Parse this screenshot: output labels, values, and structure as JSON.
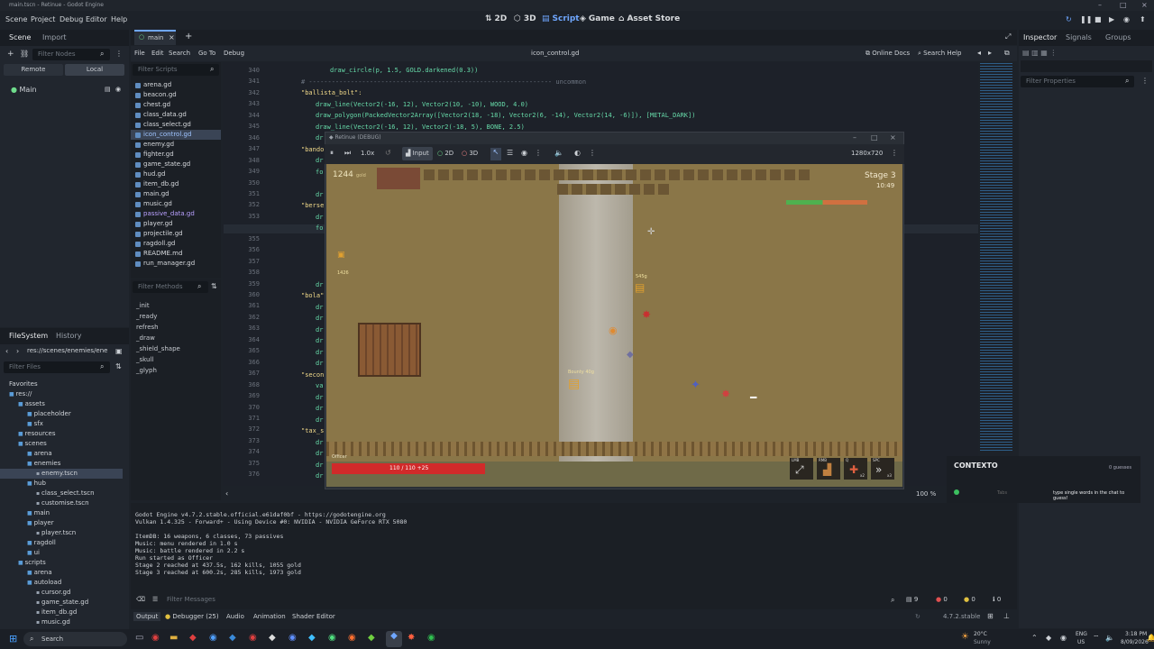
{
  "window": {
    "title": "main.tscn - Retinue - Godot Engine"
  },
  "menu": [
    "Scene",
    "Project",
    "Debug",
    "Editor",
    "Help"
  ],
  "modes": [
    {
      "icon": "2d-icon",
      "label": "2D",
      "active": false
    },
    {
      "icon": "3d-icon",
      "label": "3D",
      "active": false
    },
    {
      "icon": "script-icon",
      "label": "Script",
      "active": true
    },
    {
      "icon": "game-icon",
      "label": "Game",
      "active": false
    },
    {
      "icon": "assetlib-icon",
      "label": "Asset Store",
      "active": false
    }
  ],
  "scene_dock": {
    "tabs": [
      "Scene",
      "Import"
    ],
    "filter_placeholder": "Filter Nodes",
    "remote_label": "Remote",
    "local_label": "Local",
    "root_node": "Main"
  },
  "editor_tabs": {
    "main_tab": "main",
    "add": "+"
  },
  "script_menu": [
    "File",
    "Edit",
    "Search",
    "Go To",
    "Debug"
  ],
  "script_title": "icon_control.gd",
  "online_docs": "Online Docs",
  "search_help": "Search Help",
  "scripts_filter": "Filter Scripts",
  "scripts": [
    "arena.gd",
    "beacon.gd",
    "chest.gd",
    "class_data.gd",
    "class_select.gd",
    "icon_control.gd",
    "enemy.gd",
    "fighter.gd",
    "game_state.gd",
    "hud.gd",
    "item_db.gd",
    "main.gd",
    "music.gd",
    "passive_data.gd",
    "player.gd",
    "projectile.gd",
    "ragdoll.gd",
    "README.md",
    "run_manager.gd"
  ],
  "methods_filter": "Filter Methods",
  "methods": [
    "_init",
    "_ready",
    "refresh",
    "_draw",
    "_shield_shape",
    "_skull",
    "_glyph"
  ],
  "code": {
    "line_numbers": [
      "340",
      "341",
      "342",
      "343",
      "344",
      "345",
      "346",
      "347",
      "348",
      "349",
      "350",
      "351",
      "352",
      "353",
      "354",
      "355",
      "356",
      "357",
      "358",
      "359",
      "360",
      "361",
      "362",
      "363",
      "364",
      "365",
      "366",
      "367",
      "368",
      "369",
      "370",
      "371",
      "372",
      "373",
      "374",
      "375",
      "376"
    ],
    "l340": "draw_circle(p, 1.5, GOLD.darkened(0.3))",
    "l341": "# ---------------------------------------------------------------- uncommon",
    "l342": "\"ballista_bolt\":",
    "l343": "draw_line(Vector2(-16, 12), Vector2(10, -10), WOOD, 4.0)",
    "l344": "draw_polygon(PackedVector2Array([Vector2(18, -18), Vector2(6, -14), Vector2(14, -6)]), [METAL_DARK])",
    "l345": "draw_line(Vector2(-16, 12), Vector2(-18, 5), BONE, 2.5)",
    "l347": "\"bando",
    "l352": "\"berse",
    "l360": "\"bola\"",
    "l367": "\"secon",
    "l372": "\"tax_s",
    "frag_dr": "dr",
    "frag_fo": "fo",
    "frag_va": "va"
  },
  "zoom": "100 %",
  "filesystem": {
    "tabs": [
      "FileSystem",
      "History"
    ],
    "path": "res://scenes/enemies/ene",
    "filter_placeholder": "Filter Files",
    "tree": [
      {
        "label": "Favorites",
        "indent": 0,
        "kind": "fav"
      },
      {
        "label": "res://",
        "indent": 0,
        "kind": "folder"
      },
      {
        "label": "assets",
        "indent": 1,
        "kind": "folder"
      },
      {
        "label": "placeholder",
        "indent": 2,
        "kind": "folder"
      },
      {
        "label": "sfx",
        "indent": 2,
        "kind": "folder"
      },
      {
        "label": "resources",
        "indent": 1,
        "kind": "folder"
      },
      {
        "label": "scenes",
        "indent": 1,
        "kind": "folder"
      },
      {
        "label": "arena",
        "indent": 2,
        "kind": "folder"
      },
      {
        "label": "enemies",
        "indent": 2,
        "kind": "folder"
      },
      {
        "label": "enemy.tscn",
        "indent": 3,
        "kind": "file",
        "selected": true
      },
      {
        "label": "hub",
        "indent": 2,
        "kind": "folder"
      },
      {
        "label": "class_select.tscn",
        "indent": 3,
        "kind": "file"
      },
      {
        "label": "customise.tscn",
        "indent": 3,
        "kind": "file"
      },
      {
        "label": "main",
        "indent": 2,
        "kind": "folder"
      },
      {
        "label": "player",
        "indent": 2,
        "kind": "folder"
      },
      {
        "label": "player.tscn",
        "indent": 3,
        "kind": "file"
      },
      {
        "label": "ragdoll",
        "indent": 2,
        "kind": "folder"
      },
      {
        "label": "ui",
        "indent": 2,
        "kind": "folder"
      },
      {
        "label": "scripts",
        "indent": 1,
        "kind": "folder"
      },
      {
        "label": "arena",
        "indent": 2,
        "kind": "folder"
      },
      {
        "label": "autoload",
        "indent": 2,
        "kind": "folder"
      },
      {
        "label": "cursor.gd",
        "indent": 3,
        "kind": "file"
      },
      {
        "label": "game_state.gd",
        "indent": 3,
        "kind": "file"
      },
      {
        "label": "item_db.gd",
        "indent": 3,
        "kind": "file"
      },
      {
        "label": "music.gd",
        "indent": 3,
        "kind": "file"
      }
    ]
  },
  "game_window": {
    "title": "Retinue (DEBUG)",
    "speed": "1.0x",
    "input": "Input",
    "btn2d": "2D",
    "btn3d": "3D",
    "resolution": "1280x720",
    "gold": "1244",
    "gold_unit": "gold",
    "stage": "Stage 3",
    "timer": "10:49",
    "player_label": "Officer",
    "hp_text": "110 / 110 +25",
    "hp_fraction": 1.0,
    "chest_price_1": "1426",
    "chest_price_2": "545g",
    "chest_price_3": "Bounty 40g",
    "skills": [
      {
        "key": "LMB",
        "count": ""
      },
      {
        "key": "RMB",
        "count": ""
      },
      {
        "key": "Q",
        "count": "x2"
      },
      {
        "key": "SPC",
        "count": "x3"
      }
    ]
  },
  "contexto": {
    "title": "CONTEXTO",
    "guesses": "0 guesses",
    "hint": "type single words in the chat to guess!",
    "tabs": "Tabs"
  },
  "inspector": {
    "tabs": [
      "Inspector",
      "Signals",
      "Groups"
    ],
    "filter_placeholder": "Filter Properties"
  },
  "bottom_tabs": [
    "Output",
    "Debugger (25)",
    "Audio",
    "Animation",
    "Shader Editor"
  ],
  "filter_messages": "Filter Messages",
  "counters": [
    "9",
    "0",
    "0",
    "0"
  ],
  "version": "4.7.2.stable",
  "console": [
    "Godot Engine v4.7.2.stable.official.e61daf0bf - https://godotengine.org",
    "Vulkan 1.4.325 - Forward+ - Using Device #0: NVIDIA - NVIDIA GeForce RTX 5080",
    "",
    "ItemDB: 16 weapons, 6 classes, 73 passives",
    "Music: menu rendered in 1.0 s",
    "Music: battle rendered in 2.2 s",
    "Run started as Officer",
    "Stage 2 reached at 437.5s, 162 kills, 1055 gold",
    "Stage 3 reached at 600.2s, 285 kills, 1973 gold"
  ],
  "taskbar": {
    "search": "Search",
    "weather_temp": "20°C",
    "weather_desc": "Sunny",
    "lang": "ENG",
    "region": "US",
    "time": "3:18 PM",
    "date": "8/09/2026"
  },
  "colors": {
    "accent": "#6fa7ff",
    "arena": "#8a7648",
    "path": "#b9b4a8",
    "hp_bar": "#d12a2a",
    "gold": "#e0a030"
  }
}
